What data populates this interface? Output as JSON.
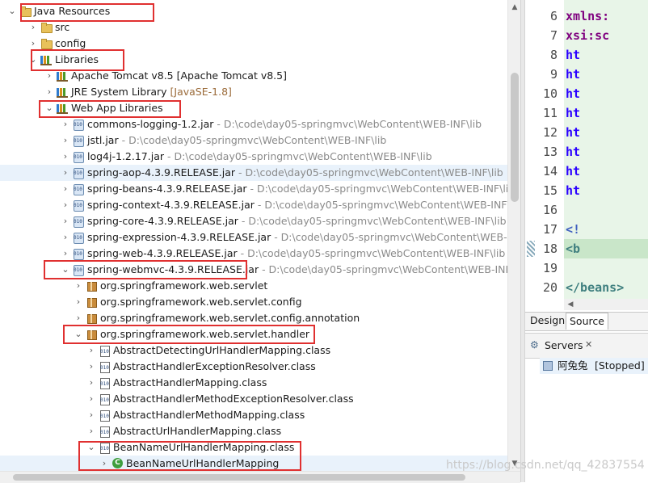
{
  "explorer": {
    "nodes": [
      {
        "label": "Java Resources",
        "deco": "",
        "icon": "folder",
        "twisty": "open"
      },
      {
        "label": "src",
        "deco": "",
        "icon": "folder",
        "twisty": "closed"
      },
      {
        "label": "config",
        "deco": "",
        "icon": "folder",
        "twisty": "closed"
      },
      {
        "label": "Libraries",
        "deco": "",
        "icon": "library",
        "twisty": "open"
      },
      {
        "label": "Apache Tomcat v8.5 [Apache Tomcat v8.5]",
        "deco": "",
        "icon": "library",
        "twisty": "closed"
      },
      {
        "label": "JRE System Library ",
        "deco": "[JavaSE-1.8]",
        "icon": "library",
        "twisty": "closed"
      },
      {
        "label": "Web App Libraries",
        "deco": "",
        "icon": "library",
        "twisty": "open"
      },
      {
        "label": "commons-logging-1.2.jar",
        "deco": " - D:\\code\\day05-springmvc\\WebContent\\WEB-INF\\lib",
        "icon": "jar",
        "twisty": "closed"
      },
      {
        "label": "jstl.jar",
        "deco": " - D:\\code\\day05-springmvc\\WebContent\\WEB-INF\\lib",
        "icon": "jar",
        "twisty": "closed"
      },
      {
        "label": "log4j-1.2.17.jar",
        "deco": " - D:\\code\\day05-springmvc\\WebContent\\WEB-INF\\lib",
        "icon": "jar",
        "twisty": "closed"
      },
      {
        "label": "spring-aop-4.3.9.RELEASE.jar",
        "deco": " - D:\\code\\day05-springmvc\\WebContent\\WEB-INF\\lib",
        "icon": "jar",
        "twisty": "closed"
      },
      {
        "label": "spring-beans-4.3.9.RELEASE.jar",
        "deco": " - D:\\code\\day05-springmvc\\WebContent\\WEB-INF\\lib",
        "icon": "jar",
        "twisty": "closed"
      },
      {
        "label": "spring-context-4.3.9.RELEASE.jar",
        "deco": " - D:\\code\\day05-springmvc\\WebContent\\WEB-INF\\lib",
        "icon": "jar",
        "twisty": "closed"
      },
      {
        "label": "spring-core-4.3.9.RELEASE.jar",
        "deco": " - D:\\code\\day05-springmvc\\WebContent\\WEB-INF\\lib",
        "icon": "jar",
        "twisty": "closed"
      },
      {
        "label": "spring-expression-4.3.9.RELEASE.jar",
        "deco": " - D:\\code\\day05-springmvc\\WebContent\\WEB-INF\\li",
        "icon": "jar",
        "twisty": "closed"
      },
      {
        "label": "spring-web-4.3.9.RELEASE.jar",
        "deco": " - D:\\code\\day05-springmvc\\WebContent\\WEB-INF\\lib",
        "icon": "jar",
        "twisty": "closed"
      },
      {
        "label": "spring-webmvc-4.3.9.RELEASE.jar",
        "deco": " - D:\\code\\day05-springmvc\\WebContent\\WEB-INF\\lib",
        "icon": "jar",
        "twisty": "open"
      },
      {
        "label": "org.springframework.web.servlet",
        "deco": "",
        "icon": "package",
        "twisty": "closed"
      },
      {
        "label": "org.springframework.web.servlet.config",
        "deco": "",
        "icon": "package",
        "twisty": "closed"
      },
      {
        "label": "org.springframework.web.servlet.config.annotation",
        "deco": "",
        "icon": "package",
        "twisty": "closed"
      },
      {
        "label": "org.springframework.web.servlet.handler",
        "deco": "",
        "icon": "package",
        "twisty": "open"
      },
      {
        "label": "AbstractDetectingUrlHandlerMapping.class",
        "deco": "",
        "icon": "class",
        "twisty": "closed"
      },
      {
        "label": "AbstractHandlerExceptionResolver.class",
        "deco": "",
        "icon": "class",
        "twisty": "closed"
      },
      {
        "label": "AbstractHandlerMapping.class",
        "deco": "",
        "icon": "class",
        "twisty": "closed"
      },
      {
        "label": "AbstractHandlerMethodExceptionResolver.class",
        "deco": "",
        "icon": "class",
        "twisty": "closed"
      },
      {
        "label": "AbstractHandlerMethodMapping.class",
        "deco": "",
        "icon": "class",
        "twisty": "closed"
      },
      {
        "label": "AbstractUrlHandlerMapping.class",
        "deco": "",
        "icon": "class",
        "twisty": "closed"
      },
      {
        "label": "BeanNameUrlHandlerMapping.class",
        "deco": "",
        "icon": "class",
        "twisty": "open"
      },
      {
        "label": "BeanNameUrlHandlerMapping",
        "deco": "",
        "icon": "class-type",
        "twisty": "closed"
      }
    ]
  },
  "editor": {
    "line_numbers": [
      "6",
      "7",
      "8",
      "9",
      "10",
      "11",
      "12",
      "13",
      "14",
      "15",
      "16",
      "17",
      "18",
      "19",
      "20"
    ],
    "code": [
      {
        "text": "    xmlns:",
        "color": "#7f007f"
      },
      {
        "text": "    xsi:sc",
        "color": "#7f007f"
      },
      {
        "text": "       ht",
        "color": "#2a00ff"
      },
      {
        "text": "       ht",
        "color": "#2a00ff"
      },
      {
        "text": "       ht",
        "color": "#2a00ff"
      },
      {
        "text": "       ht",
        "color": "#2a00ff"
      },
      {
        "text": "       ht",
        "color": "#2a00ff"
      },
      {
        "text": "       ht",
        "color": "#2a00ff"
      },
      {
        "text": "       ht",
        "color": "#2a00ff"
      },
      {
        "text": "       ht",
        "color": "#2a00ff"
      },
      {
        "text": "",
        "color": "#000000"
      },
      {
        "text": "       <!",
        "color": "#3f5fbf"
      },
      {
        "text": "       <b",
        "color": "#3f7f7f"
      },
      {
        "text": "",
        "color": "#000000"
      },
      {
        "text": "</beans>",
        "color": "#3f7f7f"
      }
    ],
    "tabs": [
      "Design",
      "Source"
    ],
    "active_tab": "Source"
  },
  "servers": {
    "title": "Servers",
    "close_glyph": "✕",
    "entry_name": "阿兔兔",
    "entry_status": "[Stopped]"
  },
  "watermark": "https://blog.csdn.net/qq_42837554",
  "colors": {
    "highlight_box": "#e03030",
    "selection": "#e9f2fb"
  }
}
